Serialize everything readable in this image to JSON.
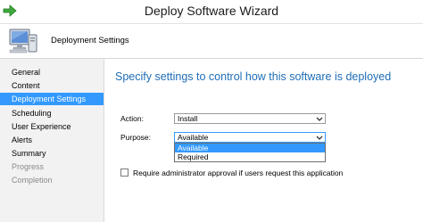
{
  "window": {
    "title": "Deploy Software Wizard"
  },
  "header": {
    "title": "Deployment Settings"
  },
  "sidebar": {
    "items": [
      {
        "label": "General",
        "state": "normal"
      },
      {
        "label": "Content",
        "state": "normal"
      },
      {
        "label": "Deployment Settings",
        "state": "active"
      },
      {
        "label": "Scheduling",
        "state": "normal"
      },
      {
        "label": "User Experience",
        "state": "normal"
      },
      {
        "label": "Alerts",
        "state": "normal"
      },
      {
        "label": "Summary",
        "state": "normal"
      },
      {
        "label": "Progress",
        "state": "disabled"
      },
      {
        "label": "Completion",
        "state": "disabled"
      }
    ]
  },
  "main": {
    "heading": "Specify settings to control how this software is deployed",
    "action": {
      "label": "Action:",
      "value": "Install"
    },
    "purpose": {
      "label": "Purpose:",
      "value": "Available",
      "options": [
        "Available",
        "Required"
      ],
      "highlighted": "Available"
    },
    "approval_checkbox": {
      "label": "Require administrator approval if users request this application",
      "checked": false
    }
  },
  "colors": {
    "accent": "#3399ff",
    "heading": "#1f6db5",
    "sidebar_bg": "#f2f2f2"
  },
  "icons": {
    "titlebar": "green-arrow-icon",
    "header": "computer-monitor-icon"
  }
}
